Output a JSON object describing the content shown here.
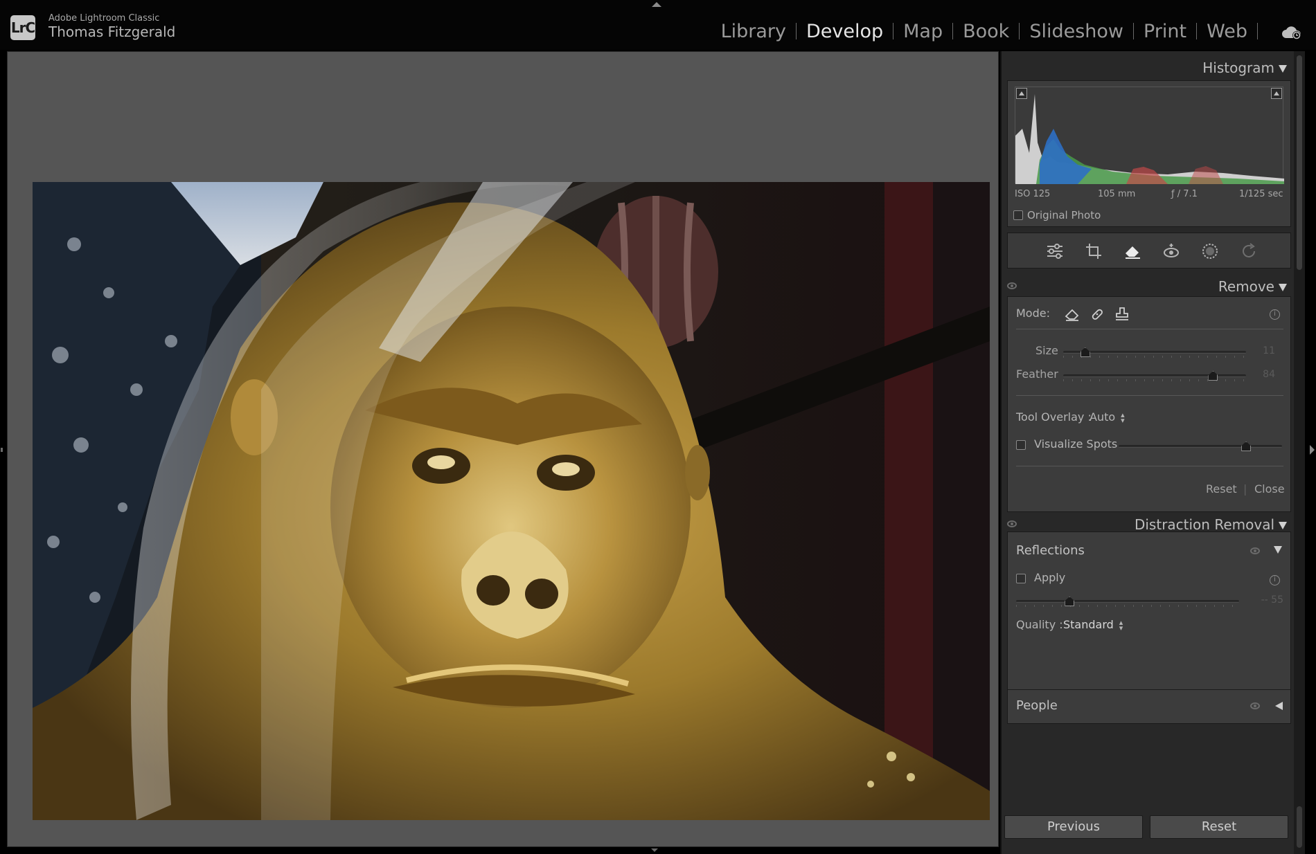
{
  "app": {
    "logo_text": "LrC",
    "name": "Adobe Lightroom Classic",
    "user": "Thomas Fitzgerald"
  },
  "modules": [
    "Library",
    "Develop",
    "Map",
    "Book",
    "Slideshow",
    "Print",
    "Web"
  ],
  "active_module": "Develop",
  "histogram": {
    "title": "Histogram",
    "iso": "ISO 125",
    "focal_length": "105 mm",
    "aperture": "ƒ / 7.1",
    "shutter": "1/125 sec",
    "original_photo_label": "Original Photo"
  },
  "tool_strip": {
    "tools": [
      "edit-sliders-icon",
      "crop-icon",
      "remove-eraser-icon",
      "red-eye-icon",
      "masking-icon",
      "reset-icon"
    ],
    "active": "remove-eraser-icon"
  },
  "remove": {
    "title": "Remove",
    "mode_label": "Mode:",
    "modes": [
      "content-aware-eraser-icon",
      "heal-bandage-icon",
      "clone-stamp-icon"
    ],
    "size_label": "Size",
    "size_value": "11",
    "size_fraction": 0.12,
    "feather_label": "Feather",
    "feather_value": "84",
    "feather_fraction": 0.82,
    "tool_overlay_label": "Tool Overlay :",
    "tool_overlay_value": "Auto",
    "visualize_label": "Visualize Spots",
    "visualize_fraction": 0.78,
    "reset_label": "Reset",
    "close_label": "Close",
    "separator": "|"
  },
  "distraction": {
    "title": "Distraction Removal",
    "reflections_title": "Reflections",
    "apply_label": "Apply",
    "amount_value": "-- 55",
    "amount_fraction": 0.24,
    "quality_label": "Quality :",
    "quality_value": "Standard",
    "people_title": "People"
  },
  "bottom": {
    "previous_label": "Previous",
    "reset_label": "Reset"
  }
}
